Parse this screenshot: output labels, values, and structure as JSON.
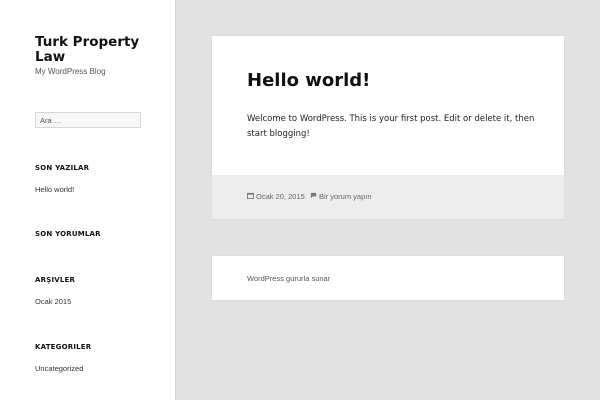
{
  "site": {
    "title": "Turk Property Law",
    "description": "My WordPress Blog"
  },
  "search": {
    "placeholder": "Ara …"
  },
  "widgets": {
    "recent_posts": {
      "title": "SON YAZILAR",
      "items": [
        "Hello world!"
      ]
    },
    "recent_comments": {
      "title": "SON YORUMLAR"
    },
    "archives": {
      "title": "ARŞIVLER",
      "items": [
        "Ocak 2015"
      ]
    },
    "categories": {
      "title": "KATEGORILER",
      "items": [
        "Uncategorized"
      ]
    }
  },
  "post": {
    "title": "Hello world!",
    "body": "Welcome to WordPress. This is your first post. Edit or delete it, then start blogging!",
    "date": "Ocak 20, 2015",
    "comment_link": "Bir yorum yapın",
    "date_icon": "calendar-icon",
    "comment_icon": "comment-icon"
  },
  "footer": {
    "text": "WordPress gururla sunar"
  },
  "colors": {
    "page_bg": "#e2e2e2",
    "sidebar_bg": "#ffffff",
    "card_bg": "#ffffff",
    "post_footer_bg": "#ededed"
  }
}
